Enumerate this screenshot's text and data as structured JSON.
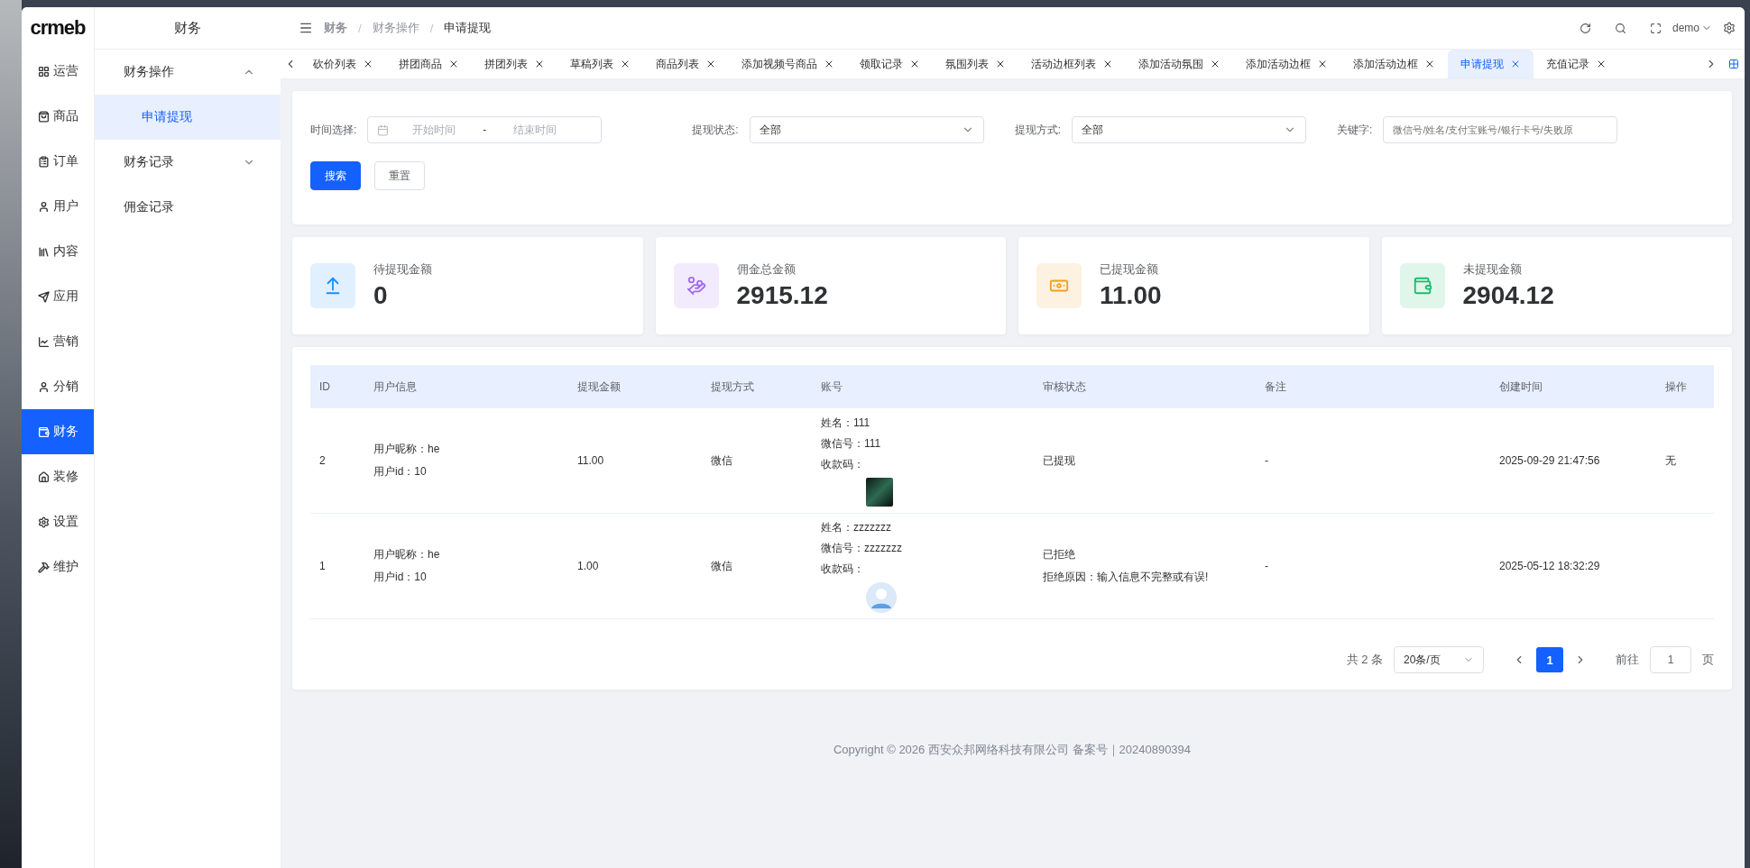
{
  "logo": "crmeb",
  "nav": [
    {
      "label": "运营",
      "selected": false
    },
    {
      "label": "商品",
      "selected": false
    },
    {
      "label": "订单",
      "selected": false
    },
    {
      "label": "用户",
      "selected": false
    },
    {
      "label": "内容",
      "selected": false
    },
    {
      "label": "应用",
      "selected": false
    },
    {
      "label": "营销",
      "selected": false
    },
    {
      "label": "分销",
      "selected": false
    },
    {
      "label": "财务",
      "selected": true
    },
    {
      "label": "装修",
      "selected": false
    },
    {
      "label": "设置",
      "selected": false
    },
    {
      "label": "维护",
      "selected": false
    }
  ],
  "submenu": {
    "title": "财务",
    "items": [
      {
        "label": "财务操作",
        "expanded": true,
        "children": [
          {
            "label": "申请提现",
            "selected": true
          }
        ]
      },
      {
        "label": "财务记录",
        "expanded": false
      },
      {
        "label": "佣金记录"
      }
    ]
  },
  "breadcrumb": [
    "财务",
    "财务操作",
    "申请提现"
  ],
  "breadcrumb_separator": "/",
  "user": "demo",
  "tabs": [
    {
      "label": "砍价列表",
      "selected": false
    },
    {
      "label": "拼团商品",
      "selected": false
    },
    {
      "label": "拼团列表",
      "selected": false
    },
    {
      "label": "草稿列表",
      "selected": false
    },
    {
      "label": "商品列表",
      "selected": false
    },
    {
      "label": "添加视频号商品",
      "selected": false
    },
    {
      "label": "领取记录",
      "selected": false
    },
    {
      "label": "氛围列表",
      "selected": false
    },
    {
      "label": "活动边框列表",
      "selected": false
    },
    {
      "label": "添加活动氛围",
      "selected": false
    },
    {
      "label": "添加活动边框",
      "selected": false
    },
    {
      "label": "添加活动边框",
      "selected": false
    },
    {
      "label": "申请提现",
      "selected": true
    },
    {
      "label": "充值记录",
      "selected": false
    }
  ],
  "filters": {
    "time": {
      "label": "时间选择:",
      "start_placeholder": "开始时间",
      "separator": "-",
      "end_placeholder": "结束时间"
    },
    "status": {
      "label": "提现状态:",
      "value": "全部"
    },
    "method": {
      "label": "提现方式:",
      "value": "全部"
    },
    "keyword": {
      "label": "关键字:",
      "placeholder": "微信号/姓名/支付宝账号/银行卡号/失败原"
    },
    "buttons": [
      "搜索",
      "重置"
    ]
  },
  "stats": [
    {
      "label": "待提现金额",
      "value": "0",
      "color": "#1890ff"
    },
    {
      "label": "佣金总金额",
      "value": "2915.12",
      "color": "#a06cf2"
    },
    {
      "label": "已提现金额",
      "value": "11.00",
      "color": "#f0a020"
    },
    {
      "label": "未提现金额",
      "value": "2904.12",
      "color": "#19be6b"
    }
  ],
  "table": {
    "columns": [
      "ID",
      "用户信息",
      "提现金额",
      "提现方式",
      "账号",
      "审核状态",
      "备注",
      "创建时间",
      "操作"
    ],
    "rows": [
      {
        "id": "2",
        "user": [
          "用户昵称：he",
          "用户id：10"
        ],
        "amount": "11.00",
        "method": "微信",
        "account": [
          "姓名：111",
          "微信号：111",
          "收款码："
        ],
        "kind": "photo",
        "status": [
          "已提现"
        ],
        "note": "-",
        "created": "2025-09-29 21:47:56",
        "action": "无"
      },
      {
        "id": "1",
        "user": [
          "用户昵称：he",
          "用户id：10"
        ],
        "amount": "1.00",
        "method": "微信",
        "account": [
          "姓名：zzzzzzz",
          "微信号：zzzzzzz",
          "收款码："
        ],
        "kind": "avatar",
        "status": [
          "已拒绝",
          "拒绝原因：输入信息不完整或有误!"
        ],
        "note": "-",
        "created": "2025-05-12 18:32:29"
      }
    ]
  },
  "pagination": {
    "total": "共 2 条",
    "page_size": "20条/页",
    "pages": [
      {
        "label": "1",
        "selected": true
      }
    ],
    "goto_label": "前往",
    "goto_value": "1",
    "page_unit": "页"
  },
  "footer": "Copyright © 2026 西安众邦网络科技有限公司 备案号｜20240890394"
}
